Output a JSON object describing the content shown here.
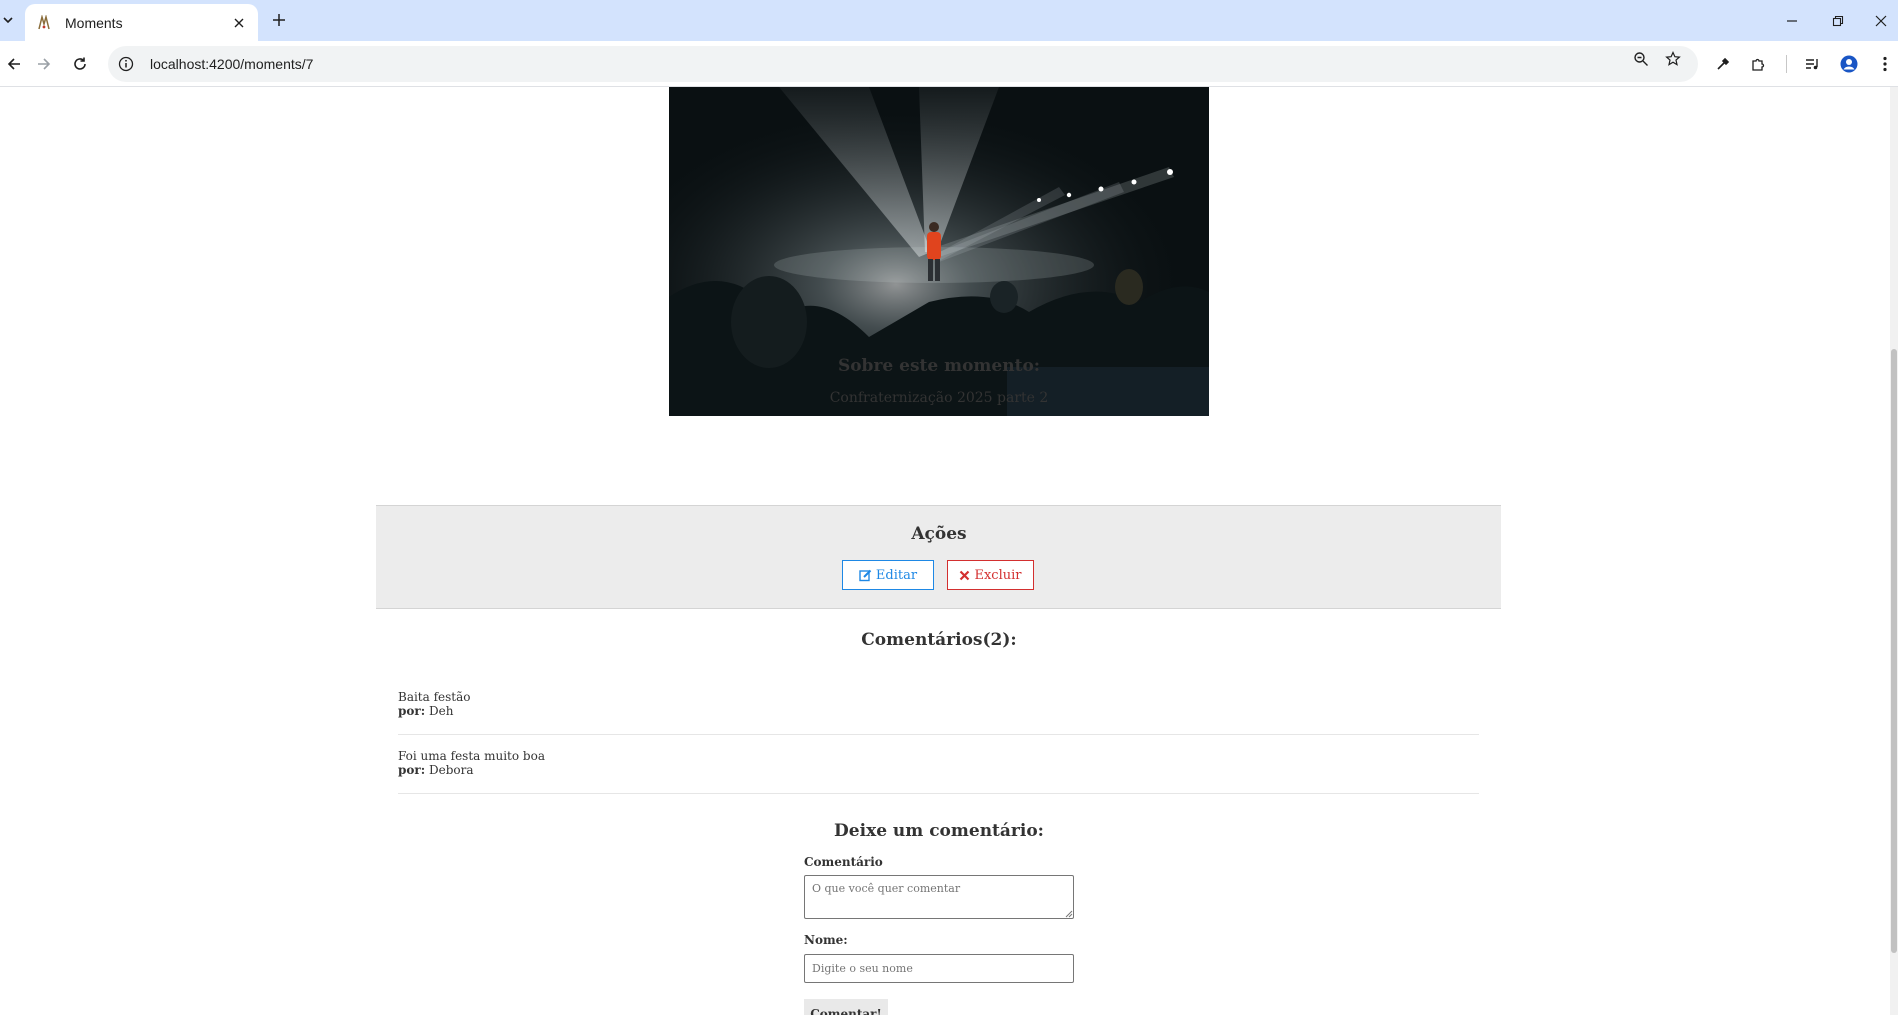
{
  "browser": {
    "tab_title": "Moments",
    "url": "localhost:4200/moments/7"
  },
  "moment": {
    "about_heading": "Sobre este momento:",
    "description": "Confraternização 2025 parte 2"
  },
  "actions": {
    "heading": "Ações",
    "edit_label": "Editar",
    "delete_label": "Excluir"
  },
  "comments": {
    "heading": "Comentários(2):",
    "by_label": "por:",
    "items": [
      {
        "text": "Baita festão",
        "author": "Deh"
      },
      {
        "text": "Foi uma festa muito boa",
        "author": "Debora"
      }
    ]
  },
  "form": {
    "heading": "Deixe um comentário:",
    "comment_label": "Comentário",
    "comment_placeholder": "O que você quer comentar",
    "name_label": "Nome:",
    "name_placeholder": "Digite o seu nome",
    "submit_label": "Comentar!"
  },
  "colors": {
    "edit": "#1e88e5",
    "delete": "#d32f2f",
    "actions_bg": "#ececec",
    "tabbar_bg": "#d3e3fd"
  },
  "icons": {
    "favicon": "moments-logo-icon",
    "edit": "edit-icon",
    "delete": "close-x-icon"
  }
}
